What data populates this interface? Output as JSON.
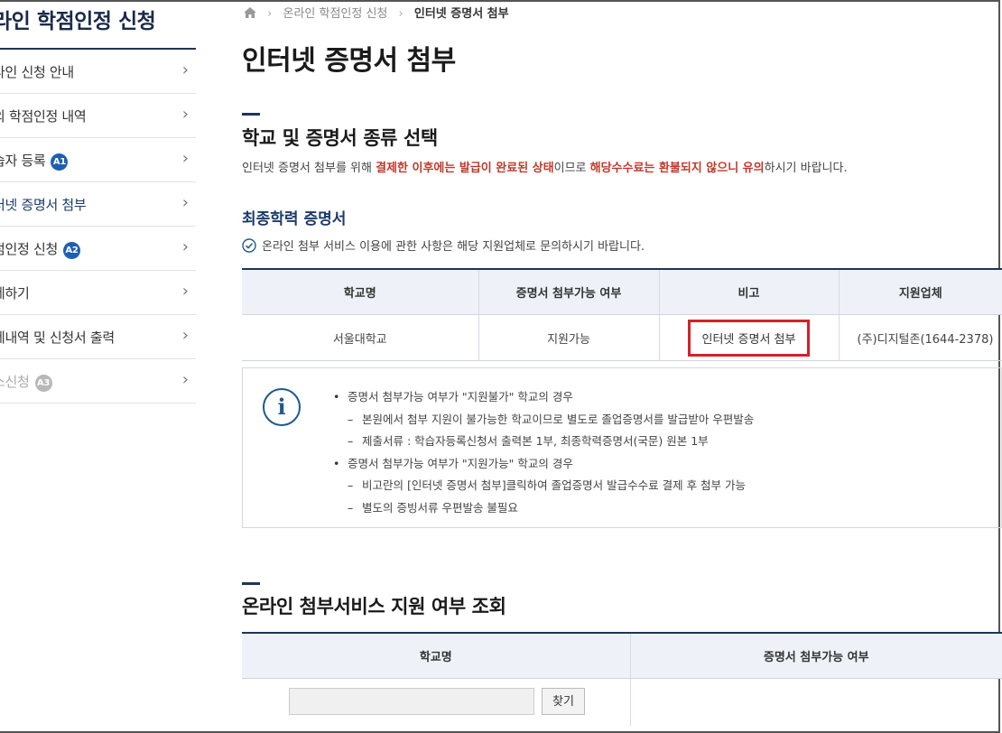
{
  "sidebar": {
    "title": "라인 학점인정 신청",
    "items": [
      {
        "label": "라인 신청 안내",
        "badge": "",
        "state": "normal"
      },
      {
        "label": "의 학점인정 내역",
        "badge": "",
        "state": "normal"
      },
      {
        "label": "습자 등록",
        "badge": "A1",
        "state": "normal"
      },
      {
        "label": "터넷 증명서 첨부",
        "badge": "",
        "state": "active"
      },
      {
        "label": "점인정 신청",
        "badge": "A2",
        "state": "normal"
      },
      {
        "label": "제하기",
        "badge": "",
        "state": "normal"
      },
      {
        "label": "제내역 및 신청서 출력",
        "badge": "",
        "state": "normal"
      },
      {
        "label": "소신청",
        "badge": "A3",
        "state": "disabled"
      }
    ]
  },
  "breadcrumb": {
    "parent": "온라인 학점인정 신청",
    "current": "인터넷 증명서 첨부"
  },
  "page_title": "인터넷 증명서 첨부",
  "section1": {
    "title": "학교 및 증명서 종류 선택",
    "notice": {
      "part1": "인터넷 증명서 첨부를 위해 ",
      "red1": "결제한 이후에는 발급이 완료된 상태",
      "part2": "이므로 ",
      "red2": "해당수수료는 환불되지 않으니 유의",
      "part3": "하시기 바랍니다."
    },
    "subtitle": "최종학력 증명서",
    "check_text": "온라인 첨부 서비스 이용에 관한 사항은 해당 지원업체로 문의하시기 바랍니다.",
    "table": {
      "headers": [
        "학교명",
        "증명서 첨부가능 여부",
        "비고",
        "지원업체"
      ],
      "row": {
        "school": "서울대학교",
        "availability": "지원가능",
        "action_label": "인터넷 증명서 첨부",
        "vendor": "(주)디지털존(1644-2378)"
      }
    },
    "info": [
      {
        "level": 1,
        "text": "증명서 첨부가능 여부가 \"지원불가\" 학교의 경우"
      },
      {
        "level": 2,
        "text": "본원에서 첨부 지원이 불가능한 학교이므로 별도로 졸업증명서를 발급받아 우편발송"
      },
      {
        "level": 2,
        "text": "제출서류 : 학습자등록신청서 출력본 1부, 최종학력증명서(국문) 원본 1부"
      },
      {
        "level": 1,
        "text": "증명서 첨부가능 여부가 \"지원가능\" 학교의 경우"
      },
      {
        "level": 2,
        "text": "비고란의 [인터넷 증명서 첨부]클릭하여 졸업증명서 발급수수료 결제 후 첨부 가능"
      },
      {
        "level": 2,
        "text": "별도의 증빙서류 우편발송 불필요"
      }
    ]
  },
  "section2": {
    "title": "온라인 첨부서비스 지원 여부 조회",
    "table": {
      "headers": [
        "학교명",
        "증명서 첨부가능 여부"
      ],
      "search_value": "",
      "find_label": "찾기"
    }
  },
  "icons": {
    "home": "home-icon",
    "chevron": "chevron-right-icon",
    "check": "check-circle-icon",
    "info": "info-icon"
  },
  "colors": {
    "navy": "#1f3458",
    "red_text": "#c0392b",
    "highlight_border": "#d62027",
    "badge_blue": "#1e5fb3"
  }
}
